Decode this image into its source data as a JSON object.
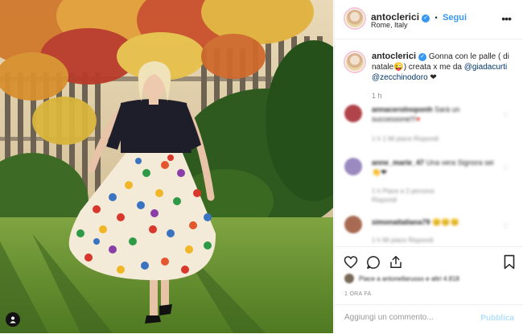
{
  "post": {
    "username": "antoclerici",
    "location": "Rome, Italy",
    "follow_label": "Segui",
    "more_label": "•••",
    "verified_glyph": "✓",
    "dot_sep": "•"
  },
  "caption": {
    "username": "antoclerici",
    "text1": "Gonna con le palle ( di natale",
    "emoji": "😜",
    "text2": ") creata x me da ",
    "mention1": "@giadacurti",
    "mention2": "@zecchinodoro",
    "heart": "❤",
    "time": "1 h"
  },
  "comments": [
    {
      "username": "annacerolnoponh",
      "text": "Sarà un successone!!!",
      "emoji": "♥",
      "meta": "1 h    1 Mi piace    Rispondi"
    },
    {
      "username": "anne_marie_47",
      "text": "Una vera Signora sei",
      "emoji": "👏❤",
      "meta": "1 h    Piace a 2 persone    Rispondi"
    },
    {
      "username": "simonaitaliana79",
      "text": "😊😊😊",
      "emoji": "",
      "meta": "1 h    Mi piace    Rispondi"
    }
  ],
  "likes": {
    "text": "Piace a antonellarusso e altri 4.818"
  },
  "date": "1 ORA FA",
  "add_comment": {
    "placeholder": "Aggiungi un commento...",
    "publish_label": "Pubblica"
  },
  "colors": {
    "accent": "#3897f0",
    "publish_disabled": "#b2dffc",
    "mention": "#003569",
    "muted": "#8e8e8e"
  },
  "icons": {
    "like": "heart-outline-icon",
    "comment": "comment-bubble-icon",
    "share": "share-icon",
    "save": "bookmark-icon",
    "photo_user": "user-tag-icon"
  }
}
